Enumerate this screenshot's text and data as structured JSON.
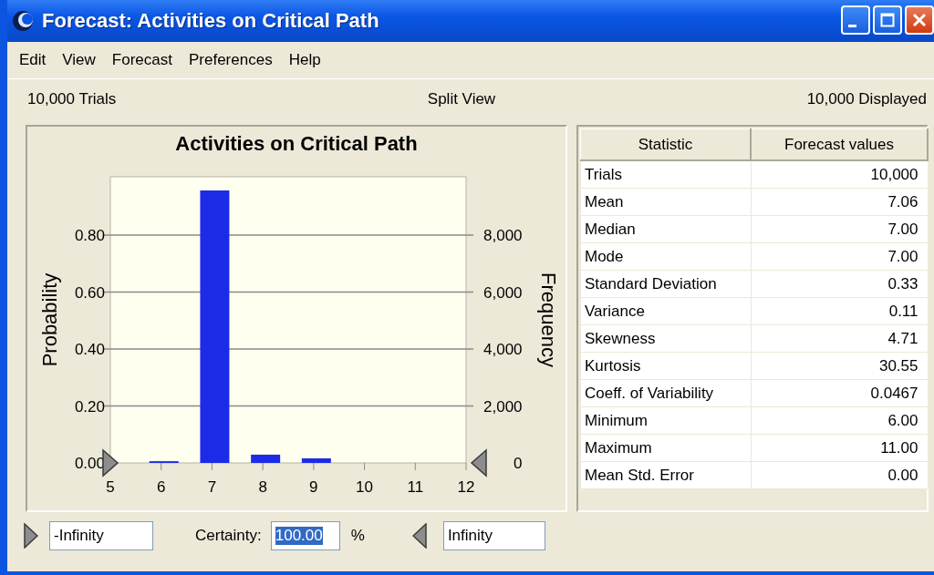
{
  "window": {
    "title": "Forecast: Activities on Critical Path"
  },
  "menu": [
    "Edit",
    "View",
    "Forecast",
    "Preferences",
    "Help"
  ],
  "info_bar": {
    "left": "10,000 Trials",
    "center": "Split View",
    "right": "10,000 Displayed"
  },
  "chart": {
    "chart_data": {
      "type": "bar",
      "title": "Activities on Critical Path",
      "ylabel": "Probability",
      "x": [
        6,
        7,
        8,
        9
      ],
      "series": [
        {
          "color": "#1c2be8",
          "values": [
            0.006,
            0.957,
            0.029,
            0.016
          ]
        }
      ],
      "grid": true,
      "xlim": [
        5,
        12
      ],
      "ylim": [
        0,
        1.005
      ],
      "xticks": [
        5,
        6,
        7,
        8,
        9,
        10,
        11,
        12
      ],
      "yticks": [
        {
          "value": 0,
          "label": "0.00"
        },
        {
          "value": 0.2,
          "label": "0.20"
        },
        {
          "value": 0.4,
          "label": "0.40"
        },
        {
          "value": 0.6,
          "label": "0.60"
        },
        {
          "value": 0.8,
          "label": "0.80"
        }
      ]
    },
    "right_axis": {
      "label": "Frequency",
      "ticks": [
        "8,000",
        "6,000",
        "4,000",
        "2,000",
        "0"
      ]
    }
  },
  "table": {
    "columns": [
      "Statistic",
      "Forecast values"
    ],
    "rows": [
      [
        "Trials",
        "10,000"
      ],
      [
        "Mean",
        "7.06"
      ],
      [
        "Median",
        "7.00"
      ],
      [
        "Mode",
        "7.00"
      ],
      [
        "Standard Deviation",
        "0.33"
      ],
      [
        "Variance",
        "0.11"
      ],
      [
        "Skewness",
        "4.71"
      ],
      [
        "Kurtosis",
        "30.55"
      ],
      [
        "Coeff. of Variability",
        "0.0467"
      ],
      [
        "Minimum",
        "6.00"
      ],
      [
        "Maximum",
        "11.00"
      ],
      [
        "Mean Std. Error",
        "0.00"
      ]
    ]
  },
  "certainty_bar": {
    "lower": "-Infinity",
    "certainty_label": "Certainty:",
    "certainty": "100.00",
    "certainty_text_selected": true,
    "unit": "%",
    "upper": "Infinity"
  }
}
